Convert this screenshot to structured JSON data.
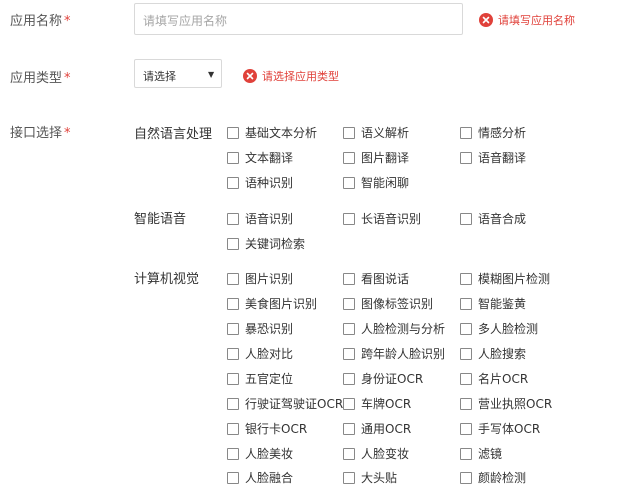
{
  "app_name": {
    "label": "应用名称",
    "required": "*",
    "placeholder": "请填写应用名称",
    "error": "请填写应用名称",
    "error_icon": "error-x-icon"
  },
  "app_type": {
    "label": "应用类型",
    "required": "*",
    "selected": "请选择",
    "error": "请选择应用类型",
    "error_icon": "error-x-icon"
  },
  "api_select": {
    "label": "接口选择",
    "required": "*",
    "categories": [
      {
        "name": "自然语言处理",
        "items": [
          "基础文本分析",
          "语义解析",
          "情感分析",
          "文本翻译",
          "图片翻译",
          "语音翻译",
          "语种识别",
          "智能闲聊"
        ]
      },
      {
        "name": "智能语音",
        "items": [
          "语音识别",
          "长语音识别",
          "语音合成",
          "关键词检索"
        ]
      },
      {
        "name": "计算机视觉",
        "items": [
          "图片识别",
          "看图说话",
          "模糊图片检测",
          "美食图片识别",
          "图像标签识别",
          "智能鉴黄",
          "暴恐识别",
          "人脸检测与分析",
          "多人脸检测",
          "人脸对比",
          "跨年龄人脸识别",
          "人脸搜索",
          "五官定位",
          "身份证OCR",
          "名片OCR",
          "行驶证驾驶证OCR",
          "车牌OCR",
          "营业执照OCR",
          "银行卡OCR",
          "通用OCR",
          "手写体OCR",
          "人脸美妆",
          "人脸变妆",
          "滤镜",
          "人脸融合",
          "大头贴",
          "颜龄检测"
        ]
      }
    ]
  },
  "colors": {
    "required_star": "#e0413a",
    "error": "#e0413a",
    "border": "#d9d9d9",
    "placeholder": "#a6a6a6"
  }
}
